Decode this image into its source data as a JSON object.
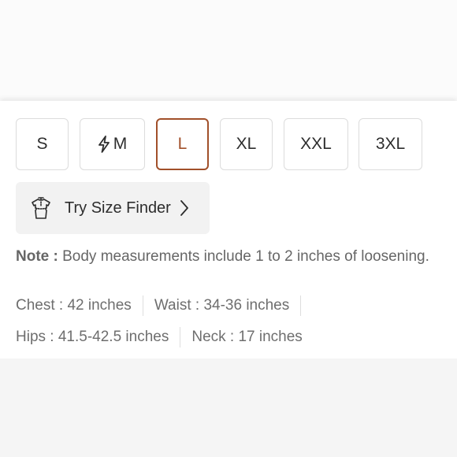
{
  "sizes": [
    {
      "label": "S",
      "selected": false,
      "icon": null
    },
    {
      "label": "M",
      "selected": false,
      "icon": "lightning-bolt-icon"
    },
    {
      "label": "L",
      "selected": true,
      "icon": null
    },
    {
      "label": "XL",
      "selected": false,
      "icon": null
    },
    {
      "label": "XXL",
      "selected": false,
      "icon": null
    },
    {
      "label": "3XL",
      "selected": false,
      "icon": null
    }
  ],
  "finder": {
    "label": "Try Size Finder",
    "icon": "mannequin-icon"
  },
  "note": {
    "prefix": "Note :",
    "text": "Body measurements include 1 to 2 inches of loosening."
  },
  "measurements": {
    "chest": "Chest : 42 inches",
    "waist": "Waist : 34-36 inches",
    "hips": "Hips : 41.5-42.5 inches",
    "neck": "Neck : 17 inches"
  },
  "colors": {
    "accent": "#a1502a"
  }
}
